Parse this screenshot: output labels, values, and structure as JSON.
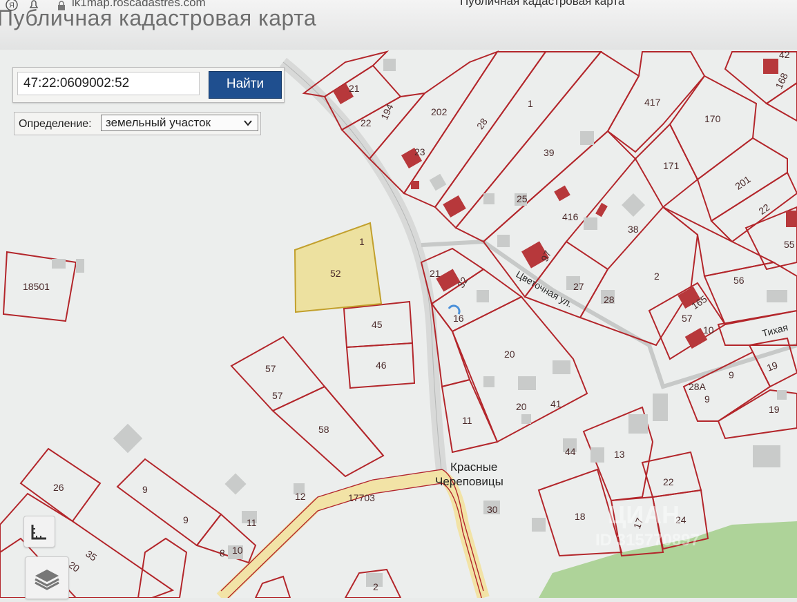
{
  "browser": {
    "url": "lk1map.roscadastres.com",
    "tab_title": "Публичная кадастровая карта",
    "page_heading": "Публичная кадастровая карта"
  },
  "search": {
    "value": "47:22:0609002:52",
    "button_label": "Найти"
  },
  "definition": {
    "label": "Определение:",
    "selected": "земельный участок"
  },
  "highlighted_parcel": {
    "label": "52",
    "corner_label": "1"
  },
  "parcel_labels": [
    "21",
    "22",
    "194",
    "202",
    "28",
    "1",
    "417",
    "170",
    "42",
    "168",
    "23",
    "39",
    "171",
    "201",
    "25",
    "416",
    "38",
    "22",
    "55",
    "18501",
    "21",
    "32",
    "97",
    "27",
    "28",
    "2",
    "56",
    "16",
    "165",
    "57",
    "10",
    "45",
    "46",
    "20",
    "57",
    "57",
    "58",
    "9",
    "28А",
    "9",
    "19",
    "19",
    "20",
    "41",
    "11",
    "13",
    "44",
    "26",
    "9",
    "9",
    "22",
    "12",
    "11",
    "18",
    "17",
    "24",
    "30",
    "8",
    "10",
    "35",
    "20",
    "2"
  ],
  "streets": {
    "tsvetochnaya": "Цветочная ул.",
    "tikhaya": "Тихая",
    "road_number": "17703"
  },
  "place_name": {
    "line1": "Красные",
    "line2": "Череповицы"
  },
  "watermark": {
    "brand": "ЦИАН",
    "id": "ID 315770897"
  },
  "colors": {
    "parcel_border": "#b3262b",
    "building": "#b7383b",
    "highlight_fill": "#eedc86",
    "highlight_border": "#c2a02d",
    "road": "#f2e3a6",
    "button": "#1f4f8f",
    "green": "#a3ce8a"
  }
}
